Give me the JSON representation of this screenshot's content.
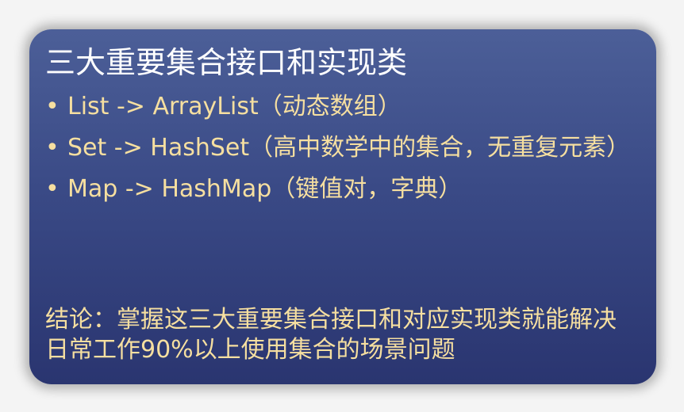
{
  "slide": {
    "title": "三大重要集合接口和实现类",
    "bullets": [
      {
        "marker": "•",
        "text": "List -> ArrayList（动态数组）"
      },
      {
        "marker": "•",
        "text": "Set -> HashSet（高中数学中的集合，无重复元素）"
      },
      {
        "marker": "•",
        "text": "Map -> HashMap（键值对，字典）"
      }
    ],
    "conclusion": "结论：掌握这三大重要集合接口和对应实现类就能解决日常工作90%以上使用集合的场景问题"
  },
  "colors": {
    "card_background": "#3a4a86",
    "title_text": "#ffffff",
    "body_text": "#f6dfa0"
  }
}
